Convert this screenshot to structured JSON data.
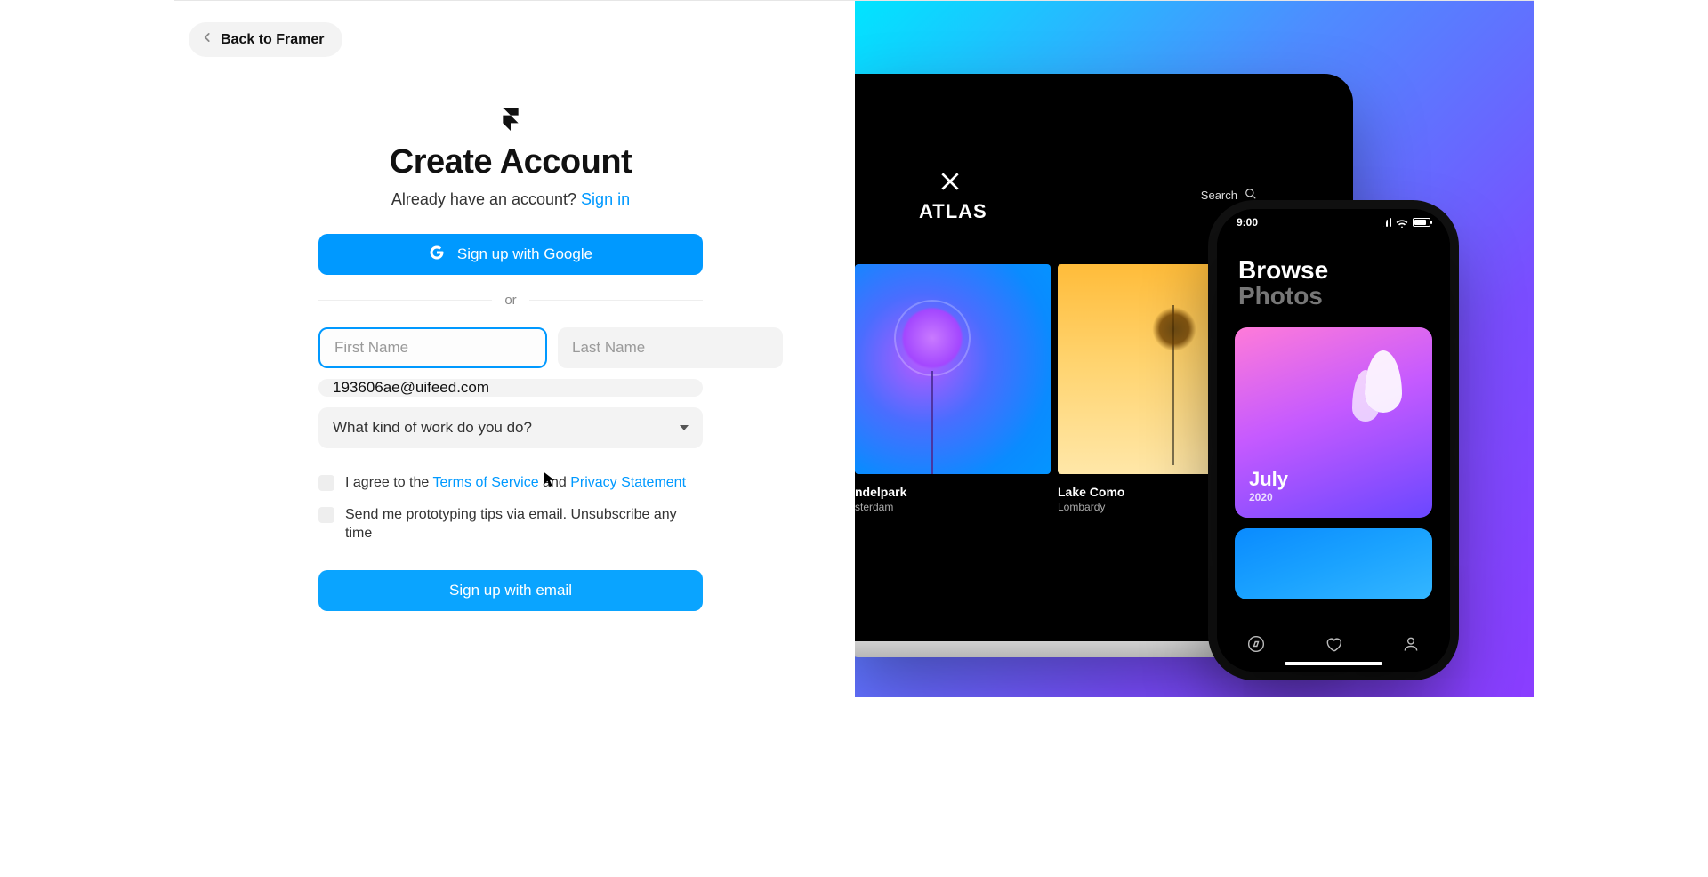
{
  "back": {
    "label": "Back to Framer"
  },
  "title": "Create Account",
  "subline": {
    "prefix": "Already have an account? ",
    "signin": "Sign in"
  },
  "google_btn": "Sign up with Google",
  "divider": "or",
  "fields": {
    "first_name": {
      "placeholder": "First Name",
      "value": ""
    },
    "last_name": {
      "placeholder": "Last Name",
      "value": ""
    },
    "email": {
      "value": "193606ae@uifeed.com"
    },
    "work": {
      "placeholder": "What kind of work do you do?"
    }
  },
  "checks": {
    "terms": {
      "prefix": "I agree to the ",
      "tos": "Terms of Service",
      "mid": " and ",
      "privacy": "Privacy Statement"
    },
    "tips": "Send me prototyping tips via email. Unsubscribe any time"
  },
  "email_btn": "Sign up with email",
  "preview": {
    "laptop": {
      "brand": "ATLAS",
      "search": "Search",
      "card_a": {
        "title": "ndelpark",
        "sub": "sterdam"
      },
      "card_b": {
        "title": "Lake Como",
        "sub": "Lombardy"
      }
    },
    "phone": {
      "time": "9:00",
      "heading_a": "Browse",
      "heading_b": "Photos",
      "card": {
        "month": "July",
        "year": "2020"
      }
    }
  }
}
